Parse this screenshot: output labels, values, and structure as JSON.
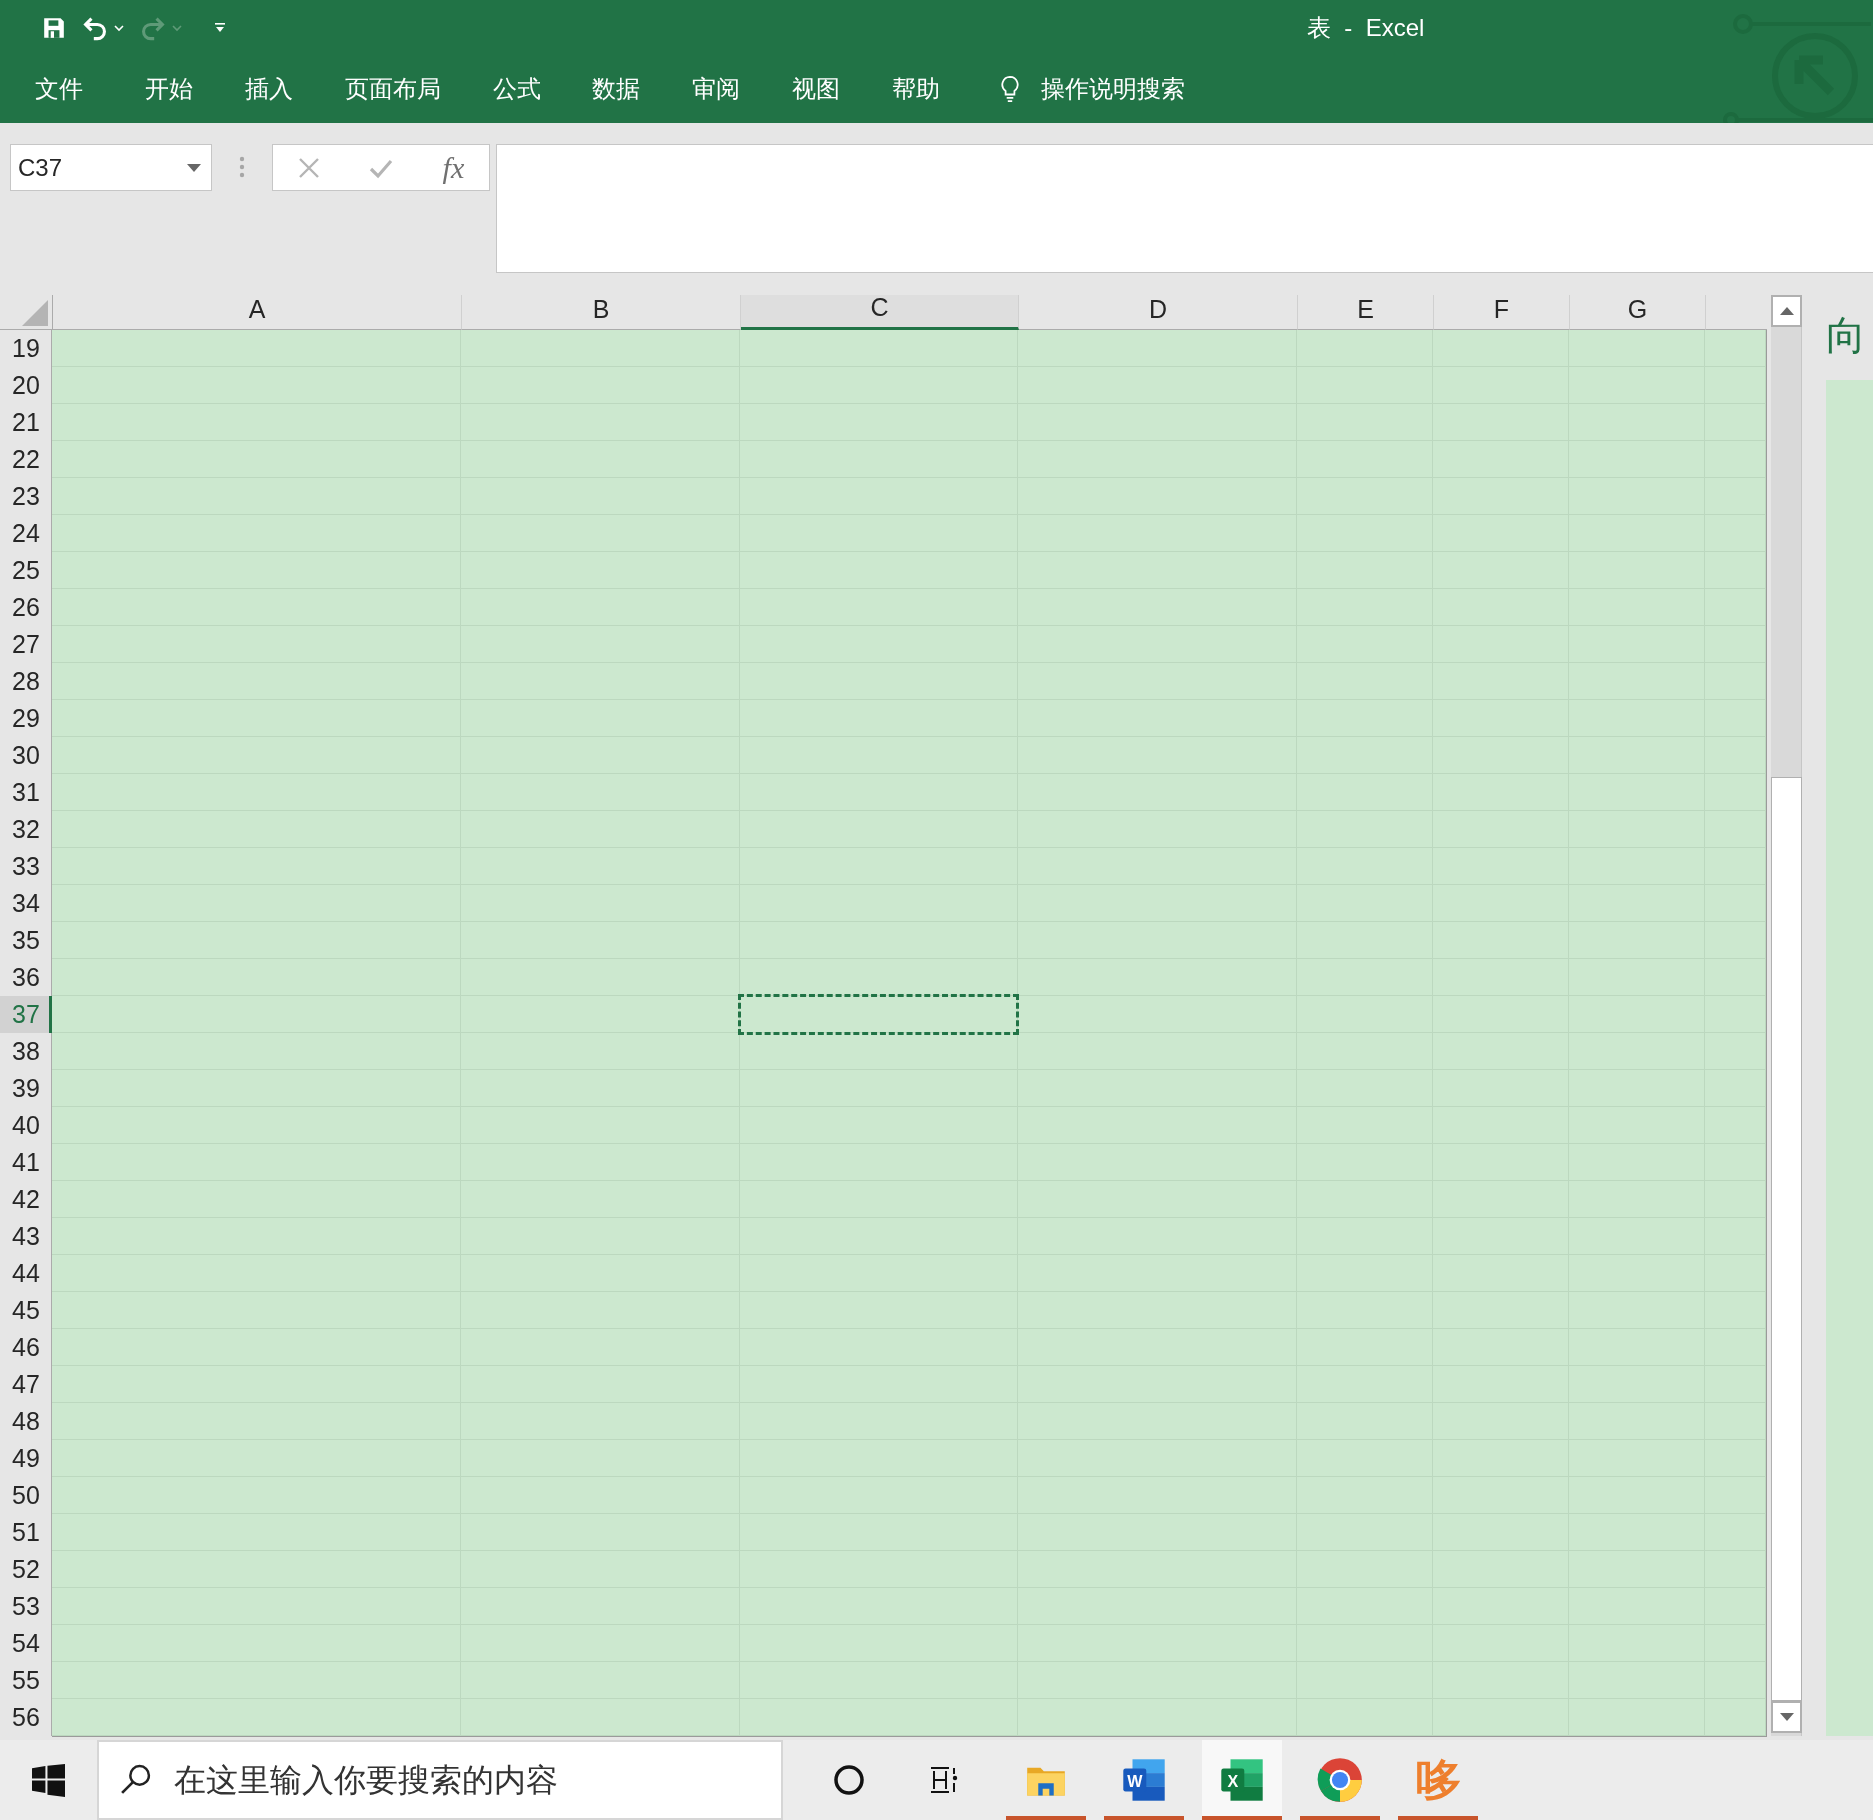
{
  "quick_access": [
    {
      "kind": "save",
      "disabled": false
    },
    {
      "kind": "undo",
      "disabled": false
    },
    {
      "kind": "redo",
      "disabled": true
    },
    {
      "kind": "customize",
      "disabled": false
    }
  ],
  "window": {
    "title": "表  -  Excel"
  },
  "ribbon_tabs": [
    "文件",
    "开始",
    "插入",
    "页面布局",
    "公式",
    "数据",
    "审阅",
    "视图",
    "帮助"
  ],
  "tell_me": {
    "label": "操作说明搜索"
  },
  "name_box": {
    "value": "C37"
  },
  "formula_buttons": {
    "fx_label": "fx"
  },
  "sheet": {
    "columns": [
      {
        "label": "A",
        "selected": false
      },
      {
        "label": "B",
        "selected": false
      },
      {
        "label": "C",
        "selected": true
      },
      {
        "label": "D",
        "selected": false
      },
      {
        "label": "E",
        "selected": false
      },
      {
        "label": "F",
        "selected": false
      },
      {
        "label": "G",
        "selected": false
      }
    ],
    "rows": [
      {
        "label": "19",
        "selected": false
      },
      {
        "label": "20",
        "selected": false
      },
      {
        "label": "21",
        "selected": false
      },
      {
        "label": "22",
        "selected": false
      },
      {
        "label": "23",
        "selected": false
      },
      {
        "label": "24",
        "selected": false
      },
      {
        "label": "25",
        "selected": false
      },
      {
        "label": "26",
        "selected": false
      },
      {
        "label": "27",
        "selected": false
      },
      {
        "label": "28",
        "selected": false
      },
      {
        "label": "29",
        "selected": false
      },
      {
        "label": "30",
        "selected": false
      },
      {
        "label": "31",
        "selected": false
      },
      {
        "label": "32",
        "selected": false
      },
      {
        "label": "33",
        "selected": false
      },
      {
        "label": "34",
        "selected": false
      },
      {
        "label": "35",
        "selected": false
      },
      {
        "label": "36",
        "selected": false
      },
      {
        "label": "37",
        "selected": true
      },
      {
        "label": "38",
        "selected": false
      },
      {
        "label": "39",
        "selected": false
      },
      {
        "label": "40",
        "selected": false
      },
      {
        "label": "41",
        "selected": false
      },
      {
        "label": "42",
        "selected": false
      },
      {
        "label": "43",
        "selected": false
      },
      {
        "label": "44",
        "selected": false
      },
      {
        "label": "45",
        "selected": false
      },
      {
        "label": "46",
        "selected": false
      },
      {
        "label": "47",
        "selected": false
      },
      {
        "label": "48",
        "selected": false
      },
      {
        "label": "49",
        "selected": false
      },
      {
        "label": "50",
        "selected": false
      },
      {
        "label": "51",
        "selected": false
      },
      {
        "label": "52",
        "selected": false
      },
      {
        "label": "53",
        "selected": false
      },
      {
        "label": "54",
        "selected": false
      },
      {
        "label": "55",
        "selected": false
      },
      {
        "label": "56",
        "selected": false
      }
    ]
  },
  "side_pane": {
    "text": "向"
  },
  "taskbar": {
    "search_placeholder": "在这里输入你要搜索的内容",
    "apps": [
      {
        "kind": "explorer",
        "running": true,
        "active": false
      },
      {
        "kind": "word",
        "letter": "W",
        "running": true,
        "active": false
      },
      {
        "kind": "excel",
        "letter": "X",
        "running": true,
        "active": true
      },
      {
        "kind": "chrome",
        "running": true,
        "active": false
      },
      {
        "kind": "text-logo",
        "letter": "哆",
        "running": true,
        "active": false
      }
    ]
  }
}
